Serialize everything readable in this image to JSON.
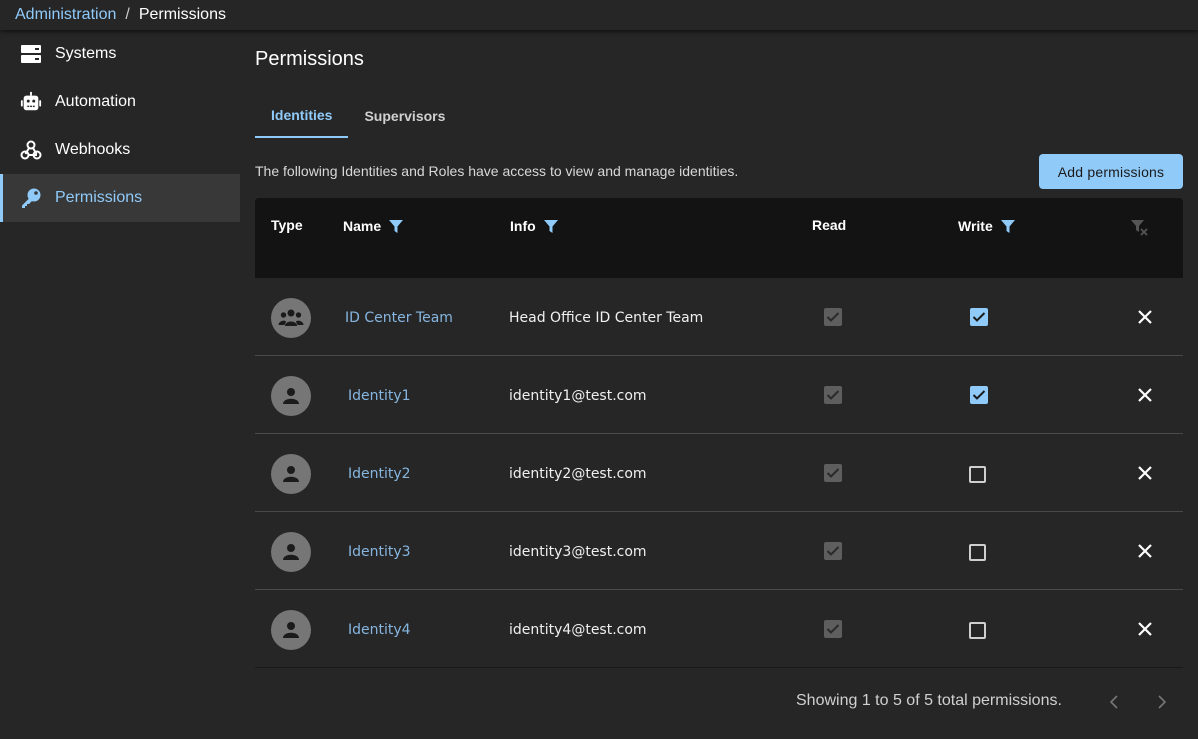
{
  "breadcrumb": {
    "parent": "Administration",
    "separator": "/",
    "current": "Permissions"
  },
  "sidebar": {
    "items": [
      {
        "label": "Systems",
        "icon": "server-icon",
        "active": false
      },
      {
        "label": "Automation",
        "icon": "robot-icon",
        "active": false
      },
      {
        "label": "Webhooks",
        "icon": "webhook-icon",
        "active": false
      },
      {
        "label": "Permissions",
        "icon": "key-icon",
        "active": true
      }
    ]
  },
  "main": {
    "title": "Permissions",
    "tabs": [
      {
        "label": "Identities",
        "active": true
      },
      {
        "label": "Supervisors",
        "active": false
      }
    ],
    "description": "The following Identities and Roles have access to view and manage identities.",
    "add_button": "Add permissions",
    "table": {
      "headers": {
        "type": "Type",
        "name": "Name",
        "info": "Info",
        "read": "Read",
        "write": "Write"
      },
      "rows": [
        {
          "type": "group",
          "name": "ID Center Team",
          "info": "Head Office ID Center Team",
          "read": true,
          "write": true
        },
        {
          "type": "person",
          "name": "Identity1",
          "info": "identity1@test.com",
          "read": true,
          "write": true
        },
        {
          "type": "person",
          "name": "Identity2",
          "info": "identity2@test.com",
          "read": true,
          "write": false
        },
        {
          "type": "person",
          "name": "Identity3",
          "info": "identity3@test.com",
          "read": true,
          "write": false
        },
        {
          "type": "person",
          "name": "Identity4",
          "info": "identity4@test.com",
          "read": true,
          "write": false
        }
      ]
    },
    "pagination": {
      "summary": "Showing 1 to 5 of 5 total permissions."
    }
  },
  "colors": {
    "accent": "#90caf9",
    "background": "#262626",
    "table_header": "#131313",
    "link": "#86b6e0"
  }
}
